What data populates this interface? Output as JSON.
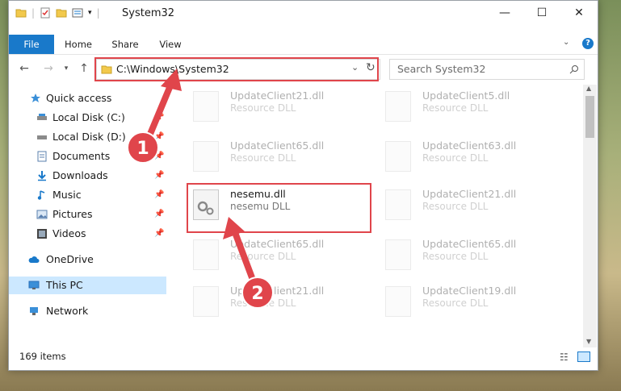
{
  "window": {
    "title": "System32"
  },
  "titlebar": {
    "minimize": "—",
    "maximize": "☐",
    "close": "✕"
  },
  "ribbon": {
    "tabs": [
      "File",
      "Home",
      "Share",
      "View"
    ],
    "help": "?"
  },
  "address": {
    "path": "C:\\Windows\\System32",
    "refresh": "↻"
  },
  "search": {
    "placeholder": "Search System32"
  },
  "nav": {
    "items": [
      {
        "label": "Quick access"
      },
      {
        "label": "Local Disk (C:)"
      },
      {
        "label": "Local Disk (D:)"
      },
      {
        "label": "Documents"
      },
      {
        "label": "Downloads"
      },
      {
        "label": "Music"
      },
      {
        "label": "Pictures"
      },
      {
        "label": "Videos"
      },
      {
        "label": "OneDrive"
      },
      {
        "label": "This PC"
      },
      {
        "label": "Network"
      }
    ]
  },
  "files": [
    {
      "name": "UpdateClient21.dll",
      "type": "Resource DLL"
    },
    {
      "name": "UpdateClient5.dll",
      "type": "Resource DLL"
    },
    {
      "name": "UpdateClient65.dll",
      "type": "Resource DLL"
    },
    {
      "name": "UpdateClient63.dll",
      "type": "Resource DLL"
    },
    {
      "name": "nesemu.dll",
      "type": "nesemu DLL"
    },
    {
      "name": "UpdateClient21.dll",
      "type": "Resource DLL"
    },
    {
      "name": "UpdateClient65.dll",
      "type": "Resource DLL"
    },
    {
      "name": "UpdateClient65.dll",
      "type": "Resource DLL"
    },
    {
      "name": "UpdateClient21.dll",
      "type": "Resource DLL"
    },
    {
      "name": "UpdateClient19.dll",
      "type": "Resource DLL"
    }
  ],
  "status": {
    "items": "169 items"
  },
  "markers": {
    "one": "1",
    "two": "2"
  },
  "colors": {
    "accent": "#1979ca",
    "highlight": "#e0454b",
    "selected": "#cce8ff"
  }
}
